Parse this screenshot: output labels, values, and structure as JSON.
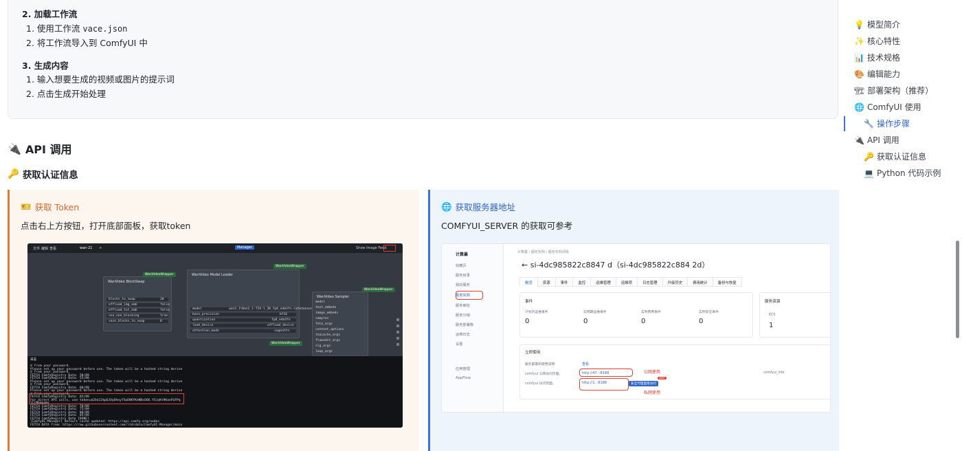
{
  "steps": {
    "step2_title": "2. 加载工作流",
    "step2_items": [
      "1. 使用工作流 ",
      "vace.json",
      "2. 将工作流导入到 ComfyUI 中"
    ],
    "step3_title": "3. 生成内容",
    "step3_items": [
      "1. 输入想要生成的视频或图片的提示词",
      "2. 点击生成开始处理"
    ]
  },
  "section": {
    "heading_icon": "🔌",
    "heading": "API 调用",
    "subheading_icon": "🔑",
    "subheading": "获取认证信息"
  },
  "left_card": {
    "icon": "🎫",
    "title": "获取 Token",
    "desc": "点击右上方按钮，打开底部面板，获取token",
    "screenshot": {
      "menu": [
        "文件",
        "编辑",
        "查看",
        "wan-21",
        "+"
      ],
      "right_menu": [
        "Manager",
        "Show Image Feed"
      ],
      "nodes": {
        "blockswap_title": "WanVideo BlockSwap",
        "loader_title": "WanVideo Model Loader",
        "sampler_title": "WanVideo Sampler",
        "wrapper": "WanVideoWrapper",
        "loader_model": "wan2.1\\Wan2_1-T2V-1_3B_fp8_e4m3fn.safetensors",
        "loader_rows": [
          "model",
          "base_precision",
          "quantization",
          "load_device",
          "attention_mode"
        ],
        "loader_values": [
          "",
          "bf16",
          "fp8_e4m3fn",
          "offload_device",
          "sageattn"
        ],
        "blockswap_rows": [
          "blocks_to_swap",
          "offload_img_emb",
          "offload_txt_emb",
          "use_non_blocking",
          "vace_blocks_to_swap"
        ],
        "blockswap_values": [
          "20",
          "false",
          "false",
          "true",
          "0"
        ],
        "sampler_rows": [
          "model",
          "text_embeds",
          "image_embeds",
          "samples",
          "feta_args",
          "context_options",
          "teacache_args",
          "flowedit_args",
          "slg_args",
          "loop_args"
        ]
      },
      "console_lines": [
        "d from your password.",
        "Please set up your password before use. The token will be a hashed string derive",
        "d from your password.",
        "FETCH ComfyRegistry Data: 50/89",
        "FETCH ComfyRegistry Data: 55/89",
        "Please set up your password before use. The token will be a hashed string derive",
        "d from your password.",
        "FETCH ComfyRegistry Data: 60/89",
        "Please set up your password before use. The token will be a hashed string derive",
        "d from your password.",
        "FETCH ComfyRegistry Data: 65/89",
        "For direct API calls, use token=$2b$12$p6JUyDhoyY5wO8KfKeNBxOGK.Y5/pKt9KanFGFPq",
        "lCrNbmoamy",
        "FETCH ComfyRegistry Data: 70/89",
        "FETCH ComfyRegistry Data: 75/89",
        "FETCH ComfyRegistry Data: 80/89",
        "FETCH ComfyRegistry Data: 85/89",
        "FETCH ComfyRegistry Data [DONE]",
        "[ComfyUI-Manager] default cache updated: https://api.comfy.org/nodes",
        "FETCH DATA from: https://raw.githubusercontent.com/ltdrdata/ComfyUI-Manager/main"
      ],
      "console_tab": "日志"
    }
  },
  "right_card": {
    "icon": "🌐",
    "title": "获取服务器地址",
    "desc": "COMFYUI_SERVER 的获取可参考",
    "screenshot": {
      "side_head": "计算巢",
      "side_items": [
        "收藏页",
        "服务目录",
        "我的服务",
        "服务实例",
        "服务审批",
        "服务分销",
        "服务部署物",
        "运维日志",
        "设置",
        "",
        "应用管理",
        "AppFlow"
      ],
      "crumb": "计算巢 / 服务实例 / 服务实例详情",
      "title": "si-4dc985822c8847          d（si-4dc985822c884          2d）",
      "tabs": [
        "概览",
        "资源",
        "事件",
        "监控",
        "运维管理",
        "运维项",
        "日志管理",
        "升级历史",
        "费用统计",
        "备份与恢复"
      ],
      "events_title": "事件",
      "events": [
        {
          "label": "计划内运维事件",
          "value": "0"
        },
        {
          "label": "非预期运维事件",
          "value": "0"
        },
        {
          "label": "实例费用事件",
          "value": "0"
        },
        {
          "label": "实例安全事件",
          "value": "0"
        }
      ],
      "resources_title": "服务资源",
      "resources_label": "ECS",
      "resources_value": "1",
      "use_title": "立即使用",
      "use_desc": "服务部署和使用说明",
      "use_view": "查看",
      "row1_label": "comfyui 公网访问页面。",
      "row1_url": "http://47.          :8188",
      "row1_note": "公网使用",
      "row2_label": "comfyui 访问页面。",
      "row2_url": "http://1.           :8188",
      "row2_badge": "安全代理直接访问",
      "row2_new": "NEW",
      "row2_note": "私网使用",
      "info": "comfyui_info"
    }
  },
  "toc": {
    "items": [
      {
        "icon": "💡",
        "label": "模型简介"
      },
      {
        "icon": "✨",
        "label": "核心特性"
      },
      {
        "icon": "📊",
        "label": "技术规格"
      },
      {
        "icon": "🎨",
        "label": "编辑能力"
      },
      {
        "icon": "🏗",
        "label": "部署架构（推荐）"
      },
      {
        "icon": "🌐",
        "label": "ComfyUI 使用"
      },
      {
        "icon": "🔧",
        "label": "操作步骤"
      },
      {
        "icon": "🔌",
        "label": "API 调用"
      },
      {
        "icon": "🔑",
        "label": "获取认证信息"
      },
      {
        "icon": "💻",
        "label": "Python 代码示例"
      }
    ]
  }
}
